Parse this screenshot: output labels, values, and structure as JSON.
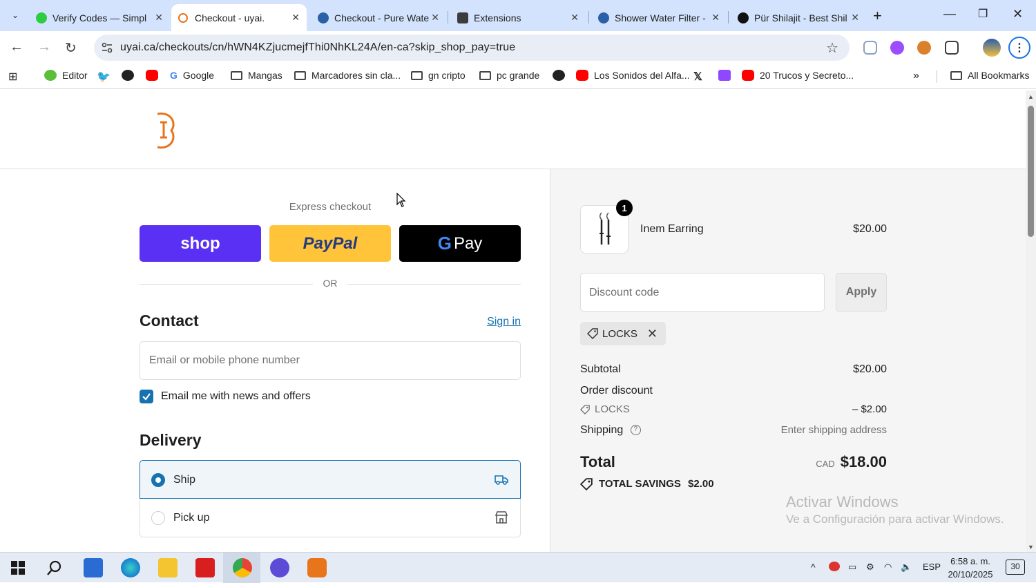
{
  "browser": {
    "tabs": [
      {
        "title": "Verify Codes — Simpl",
        "favicon_color": "#2ecc40",
        "active": false
      },
      {
        "title": "Checkout - uyai.",
        "favicon_color": "#e8741c",
        "active": true
      },
      {
        "title": "Checkout - Pure Wate",
        "favicon_color": "#2b5fa8",
        "active": false
      },
      {
        "title": "Extensions",
        "favicon_color": "#3c3c3c",
        "active": false
      },
      {
        "title": "Shower Water Filter -",
        "favicon_color": "#2b5fa8",
        "active": false
      },
      {
        "title": "Pür Shilajit - Best Shil",
        "favicon_color": "#111111",
        "active": false
      }
    ],
    "url": "uyai.ca/checkouts/cn/hWN4KZjucmejfThi0NhKL24A/en-ca?skip_shop_pay=true",
    "bookmarks": [
      {
        "label": "Editor",
        "icon": "editor-icon"
      },
      {
        "label": "",
        "icon": "twitter-icon"
      },
      {
        "label": "",
        "icon": "globe-icon"
      },
      {
        "label": "",
        "icon": "youtube-icon"
      },
      {
        "label": "Google",
        "icon": "google-icon"
      },
      {
        "label": "Mangas",
        "icon": "folder-icon"
      },
      {
        "label": "Marcadores sin cla...",
        "icon": "folder-icon"
      },
      {
        "label": "gn cripto",
        "icon": "folder-icon"
      },
      {
        "label": "pc grande",
        "icon": "folder-icon"
      },
      {
        "label": "",
        "icon": "globe-icon"
      },
      {
        "label": "Los Sonidos del Alfa...",
        "icon": "youtube-icon"
      },
      {
        "label": "",
        "icon": "x-icon"
      },
      {
        "label": "",
        "icon": "twitch-icon"
      },
      {
        "label": "20 Trucos y Secreto...",
        "icon": "youtube-icon"
      }
    ],
    "all_bookmarks": "All Bookmarks"
  },
  "checkout": {
    "express_label": "Express checkout",
    "pay_buttons": {
      "shop": "shop",
      "paypal": "PayPal",
      "gpay": "Pay"
    },
    "or_label": "OR",
    "contact": {
      "heading": "Contact",
      "sign_in": "Sign in",
      "email_placeholder": "Email or mobile phone number",
      "newsletter_label": "Email me with news and offers",
      "newsletter_checked": true
    },
    "delivery": {
      "heading": "Delivery",
      "options": [
        {
          "label": "Ship",
          "selected": true,
          "icon": "truck-icon"
        },
        {
          "label": "Pick up",
          "selected": false,
          "icon": "store-icon"
        }
      ]
    }
  },
  "summary": {
    "item": {
      "quantity": "1",
      "name": "Inem Earring",
      "price": "$20.00"
    },
    "discount_placeholder": "Discount code",
    "apply_label": "Apply",
    "applied_code": "LOCKS",
    "subtotal_label": "Subtotal",
    "subtotal_value": "$20.00",
    "order_discount_label": "Order discount",
    "discount_code_label": "LOCKS",
    "discount_value": "– $2.00",
    "shipping_label": "Shipping",
    "shipping_value": "Enter shipping address",
    "total_label": "Total",
    "currency": "CAD",
    "total_value": "$18.00",
    "savings_label": "TOTAL SAVINGS",
    "savings_value": "$2.00"
  },
  "os": {
    "watermark_title": "Activar Windows",
    "watermark_sub": "Ve a Configuración para activar Windows.",
    "language": "ESP",
    "time": "6:58 a. m.",
    "date": "20/10/2025",
    "notifications": "30"
  },
  "colors": {
    "shop_pay": "#5a31f4",
    "paypal": "#ffc439",
    "gpay": "#000000",
    "accent": "#1773b0",
    "brand_orange": "#e8741c"
  }
}
